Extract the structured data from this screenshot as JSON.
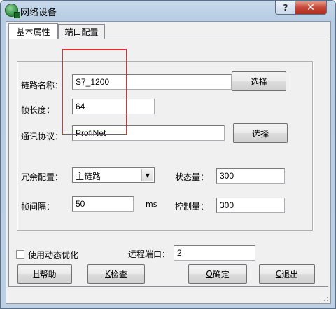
{
  "window": {
    "title": "网络设备",
    "help_glyph": "?",
    "close_glyph": "✕"
  },
  "tabs": [
    {
      "label": "基本属性"
    },
    {
      "label": "端口配置"
    }
  ],
  "form": {
    "link_name_label": "链路名称：",
    "link_name_value": "S7_1200",
    "frame_length_label": "帧长度：",
    "frame_length_value": "64",
    "protocol_label": "通讯协议：",
    "protocol_value": "ProfiNet",
    "select_label": "选择",
    "redundancy_label": "冗余配置：",
    "redundancy_value": "主链路",
    "status_label": "状态量：",
    "status_value": "300",
    "interval_label": "帧间隔：",
    "interval_value": "50",
    "interval_unit": "ms",
    "control_label": "控制量：",
    "control_value": "300",
    "dynamic_opt_label": "使用动态优化",
    "remote_port_label": "远程端口：",
    "remote_port_value": "2"
  },
  "buttons": {
    "help_key": "H",
    "help": "帮助",
    "check_key": "K",
    "check": "检查",
    "ok_key": "O",
    "ok": "确定",
    "cancel_key": "C",
    "cancel": "退出"
  },
  "colors": {
    "highlight_box": "#e03030"
  }
}
